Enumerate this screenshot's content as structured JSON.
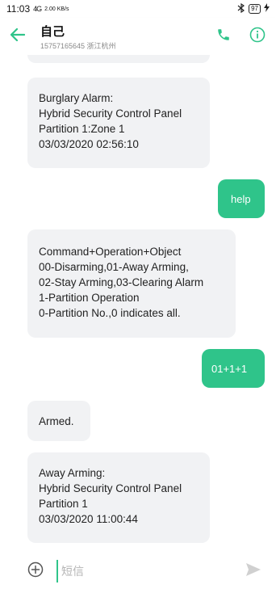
{
  "status": {
    "time": "11:03",
    "signal": "4G",
    "speed": "2.00 KB/s",
    "battery": "97",
    "bluetooth_icon": "bluetooth-icon",
    "charging_icon": "charging-icon"
  },
  "header": {
    "contact_name": "自己",
    "contact_sub": "15757165645 浙江杭州",
    "back_icon": "back-arrow-icon",
    "call_icon": "phone-icon",
    "info_icon": "info-icon"
  },
  "messages": [
    {
      "direction": "in",
      "text": "Burglary Alarm:\nHybrid Security Control Panel\nPartition 1:Zone 1\n03/03/2020 02:56:10"
    },
    {
      "direction": "out",
      "text": "help"
    },
    {
      "direction": "in",
      "text": "Command+Operation+Object\n00-Disarming,01-Away Arming,\n02-Stay Arming,03-Clearing Alarm\n1-Partition Operation\n0-Partition No.,0 indicates all."
    },
    {
      "direction": "out",
      "text": "01+1+1"
    },
    {
      "direction": "in",
      "text": "Armed."
    },
    {
      "direction": "in",
      "text": "Away Arming:\nHybrid Security Control Panel\nPartition 1\n03/03/2020 11:00:44"
    }
  ],
  "composer": {
    "placeholder": "短信",
    "value": "",
    "add_icon": "plus-circle-icon",
    "send_icon": "send-icon"
  },
  "colors": {
    "accent": "#2fc48a",
    "incoming_bubble": "#f1f2f4"
  }
}
